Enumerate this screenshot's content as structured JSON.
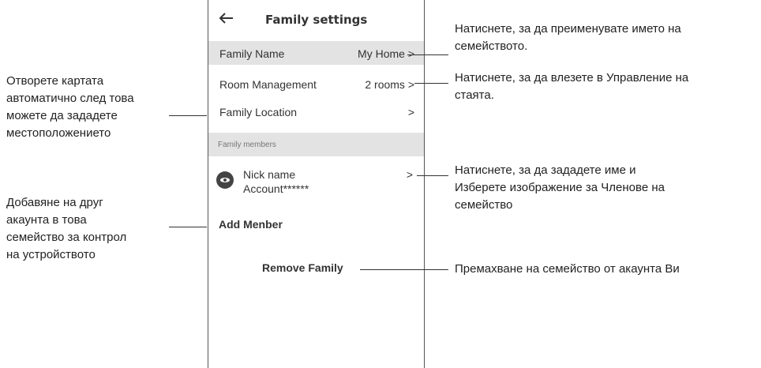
{
  "header": {
    "title": "Family settings",
    "back_icon": "arrow-left-icon"
  },
  "rows": {
    "family_name": {
      "label": "Family Name",
      "value": "My Home >"
    },
    "room_management": {
      "label": "Room Management",
      "value": "2 rooms >"
    },
    "family_location": {
      "label": "Family Location",
      "value": ">"
    }
  },
  "members_section": {
    "title": "Family members",
    "member": {
      "nick": "Nick name",
      "account": "Account******",
      "arrow": ">"
    }
  },
  "add_member_label": "Add Menber",
  "remove_family_label": "Remove Family",
  "annotations": {
    "right_1": [
      "Натиснете, за да преименувате името на",
      "семейството."
    ],
    "right_2": [
      "Натиснете, за да влезете в Управление на",
      "стаята."
    ],
    "right_3": [
      "Натиснете, за да зададете име и",
      "Изберете изображение за Членове на",
      "семейство"
    ],
    "right_4": [
      "Премахване на семейство от акаунта Ви"
    ],
    "left_1": [
      "Отворете картата",
      "автоматично след това",
      "можете да зададете",
      "местоположението"
    ],
    "left_2": [
      "Добавяне на друг",
      "акаунта в това",
      "семейство за контрол",
      "на устройството"
    ]
  },
  "colors": {
    "row_highlight": "#e3e3e3",
    "text": "#333333",
    "frame": "#555555"
  }
}
